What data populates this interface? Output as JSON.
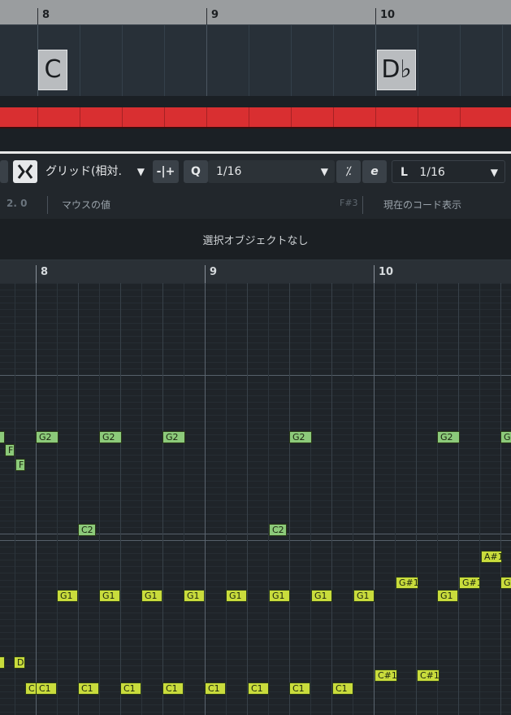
{
  "ruler_top": {
    "bars": [
      "8",
      "9",
      "10"
    ]
  },
  "chord_track": {
    "chords": [
      {
        "name": "C"
      },
      {
        "name": "D♭"
      }
    ]
  },
  "toolbar": {
    "snap_mode": "グリッド(相対.",
    "quantize_label": "Q",
    "quantize_value": "1/16",
    "length_label": "L",
    "length_value": "1/16"
  },
  "info_row": {
    "position": "2.  0",
    "mouse_value_label": "マウスの値",
    "mouse_pitch": "F#3",
    "current_chord_label": "現在のコード表示"
  },
  "status": {
    "selection": "選択オブジェクトなし"
  },
  "ruler_bottom": {
    "bars": [
      "8",
      "9",
      "10"
    ]
  },
  "notes": [
    {
      "label": "G",
      "color": "green"
    },
    {
      "label": "G2",
      "color": "green"
    },
    {
      "label": "G2",
      "color": "green"
    },
    {
      "label": "G2",
      "color": "green"
    },
    {
      "label": "G2",
      "color": "green"
    },
    {
      "label": "G2",
      "color": "green"
    },
    {
      "label": "G",
      "color": "green"
    },
    {
      "label": "F",
      "color": "green"
    },
    {
      "label": "F",
      "color": "green"
    },
    {
      "label": "C2",
      "color": "green"
    },
    {
      "label": "C2",
      "color": "green"
    },
    {
      "label": "A#1",
      "color": "yellow"
    },
    {
      "label": "G#1",
      "color": "yellow"
    },
    {
      "label": "G#1",
      "color": "yellow"
    },
    {
      "label": "G",
      "color": "yellow"
    },
    {
      "label": "G1",
      "color": "yellow"
    },
    {
      "label": "G1",
      "color": "yellow"
    },
    {
      "label": "G1",
      "color": "yellow"
    },
    {
      "label": "G1",
      "color": "yellow"
    },
    {
      "label": "G1",
      "color": "yellow"
    },
    {
      "label": "G1",
      "color": "yellow"
    },
    {
      "label": "G1",
      "color": "yellow"
    },
    {
      "label": "G1",
      "color": "yellow"
    },
    {
      "label": "G1",
      "color": "yellow"
    },
    {
      "label": "D",
      "color": "yellow"
    },
    {
      "label": "D",
      "color": "yellow"
    },
    {
      "label": "C#1",
      "color": "yellow"
    },
    {
      "label": "C#1",
      "color": "yellow"
    },
    {
      "label": "C",
      "color": "yellow"
    },
    {
      "label": "C1",
      "color": "yellow"
    },
    {
      "label": "C1",
      "color": "yellow"
    },
    {
      "label": "C1",
      "color": "yellow"
    },
    {
      "label": "C1",
      "color": "yellow"
    },
    {
      "label": "C1",
      "color": "yellow"
    },
    {
      "label": "C1",
      "color": "yellow"
    },
    {
      "label": "C1",
      "color": "yellow"
    },
    {
      "label": "C1",
      "color": "yellow"
    }
  ],
  "colors": {
    "note_green": "#8cca7a",
    "note_yellow": "#c9dc3c",
    "overview_red": "#d92f31",
    "ruler_top": "#9a9d9f"
  }
}
